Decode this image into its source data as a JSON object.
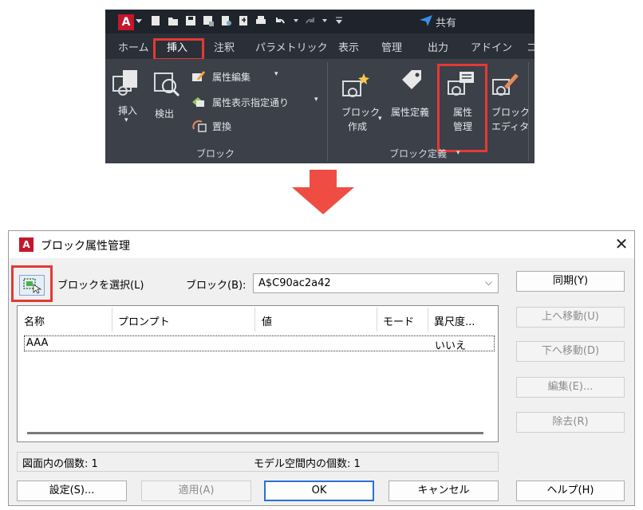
{
  "ribbon": {
    "app_button": "A",
    "share_label": "共有",
    "tabs": [
      "ホーム",
      "挿入",
      "注釈",
      "パラメトリック",
      "表示",
      "管理",
      "出力",
      "アドイン",
      "コ"
    ],
    "block_panel": {
      "insert_label": "挿入",
      "detect_label": "検出",
      "attr_edit": "属性編集",
      "attr_display": "属性表示指定通り",
      "replace": "置換",
      "title": "ブロック"
    },
    "block_def_panel": {
      "create_line1": "ブロック",
      "create_line2": "作成",
      "attr_define": "属性定義",
      "attr_manage_line1": "属性",
      "attr_manage_line2": "管理",
      "editor_line1": "ブロック",
      "editor_line2": "エディタ",
      "title": "ブロック定義"
    }
  },
  "dialog": {
    "title": "ブロック属性管理",
    "select_block_label": "ブロックを選択(L)",
    "block_label": "ブロック(B):",
    "block_value": "A$C90ac2a42",
    "columns": [
      "名称",
      "プロンプト",
      "値",
      "モード",
      "異尺度..."
    ],
    "rows": [
      {
        "name": "AAA",
        "prompt": "",
        "value": "",
        "mode": "",
        "annotative": "いいえ"
      }
    ],
    "status_drawing": "図面内の個数: 1",
    "status_model": "モデル空間内の個数: 1",
    "side_buttons": {
      "sync": "同期(Y)",
      "move_up": "上へ移動(U)",
      "move_down": "下へ移動(D)",
      "edit": "編集(E)...",
      "remove": "除去(R)"
    },
    "bottom_buttons": {
      "settings": "設定(S)...",
      "apply": "適用(A)",
      "ok": "OK",
      "cancel": "キャンセル",
      "help": "ヘルプ(H)"
    }
  },
  "colors": {
    "highlight": "#e53935",
    "arrow": "#ef4d44",
    "ribbon_bg": "#2b2f38",
    "autocad_red": "#c4172c"
  }
}
